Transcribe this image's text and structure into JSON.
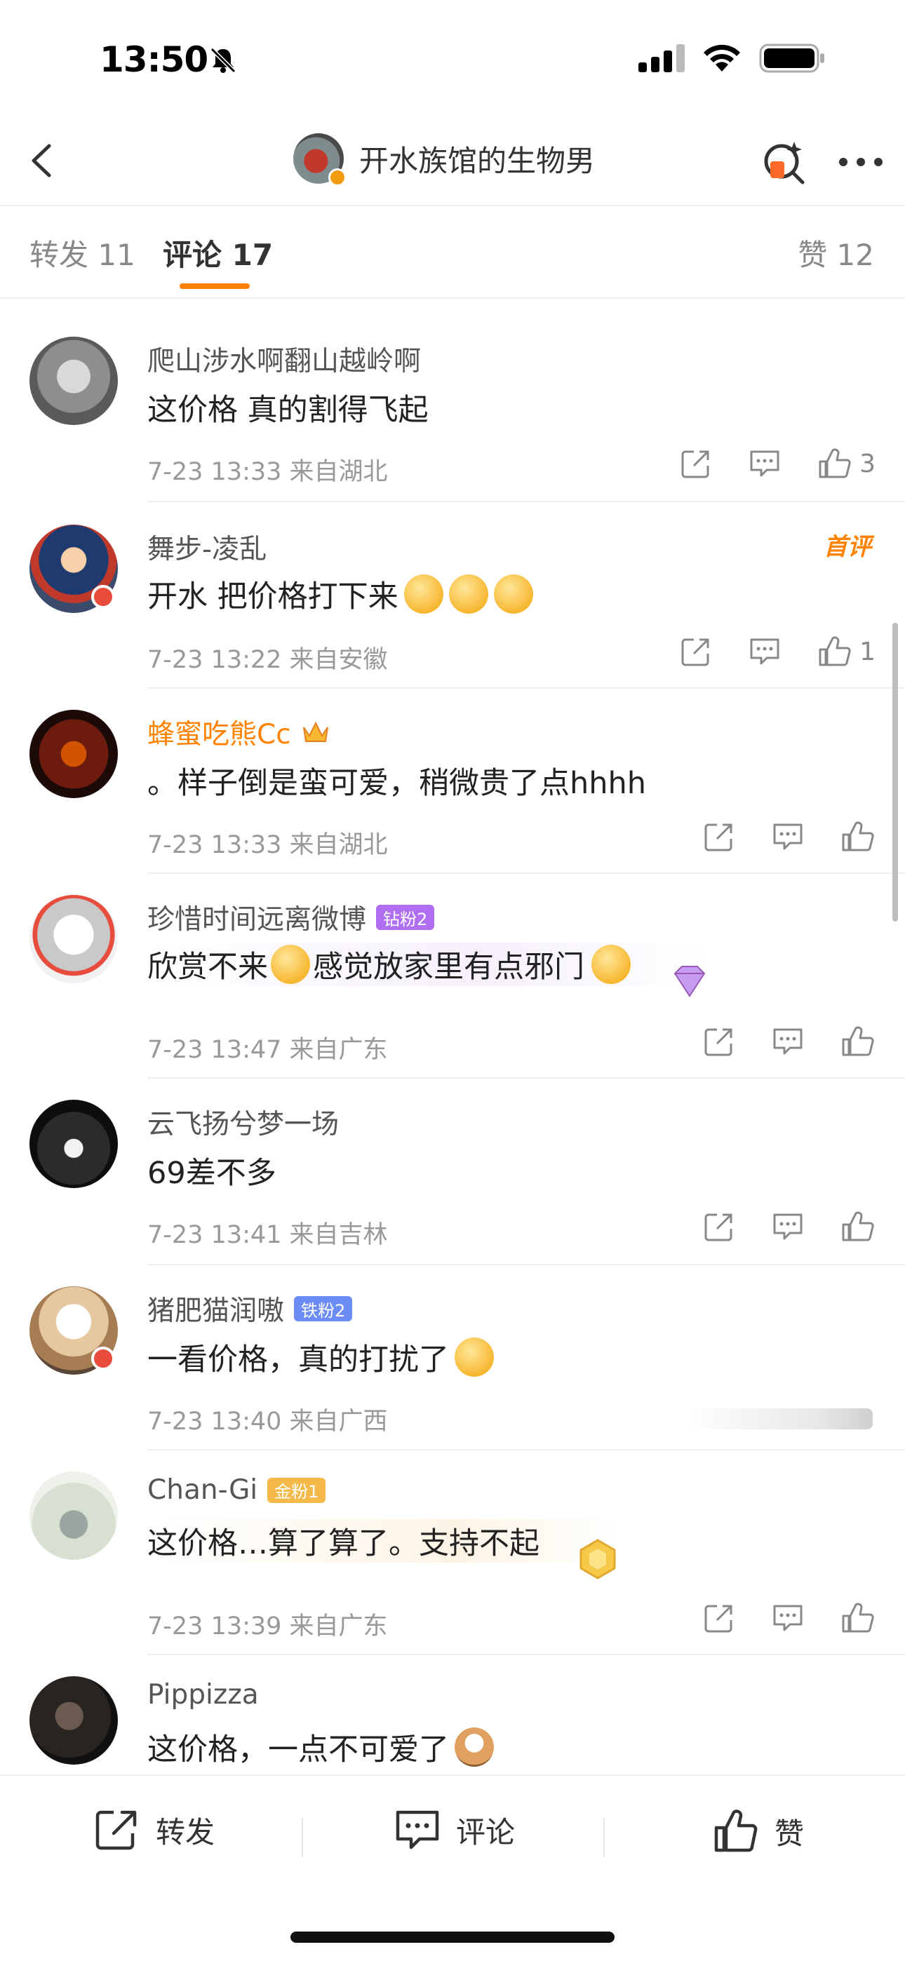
{
  "status_bar": {
    "time": "13:50"
  },
  "header": {
    "title": "开水族馆的生物男"
  },
  "tabs": [
    {
      "label": "转发 11"
    },
    {
      "label": "评论 17"
    },
    {
      "label": "赞 12"
    }
  ],
  "comments": [
    {
      "name": "爬山涉水啊翻山越岭啊",
      "text": "这价格 真的割得飞起",
      "meta": "7-23 13:33  来自湖北",
      "likes": "3"
    },
    {
      "name": "舞步-凌乱",
      "text": "开水 把价格打下来",
      "meta": "7-23 13:22  来自安徽",
      "likes": "1",
      "first_label": "首评"
    },
    {
      "name": "蜂蜜吃熊Cc",
      "text": "。样子倒是蛮可爱，稍微贵了点hhhh",
      "meta": "7-23 13:33  来自湖北"
    },
    {
      "name": "珍惜时间远离微博",
      "badge": "钻粉2",
      "text_a": "欣赏不来",
      "text_b": "感觉放家里有点邪门",
      "meta": "7-23 13:47  来自广东"
    },
    {
      "name": "云飞扬兮梦一场",
      "text": "69差不多",
      "meta": "7-23 13:41  来自吉林"
    },
    {
      "name": "猪肥猫润嗷",
      "badge": "铁粉2",
      "text": "一看价格，真的打扰了",
      "meta": "7-23 13:40  来自广西"
    },
    {
      "name": "Chan-Gi",
      "badge": "金粉1",
      "text": "这价格…算了算了。支持不起",
      "meta": "7-23 13:39  来自广东"
    },
    {
      "name": "Pippizza",
      "text": "这价格，一点不可爱了"
    }
  ],
  "bottom_bar": {
    "repost": "转发",
    "comment": "评论",
    "like": "赞"
  },
  "colors": {
    "accent": "#ff8200",
    "text": "#333333",
    "meta": "#999999"
  }
}
